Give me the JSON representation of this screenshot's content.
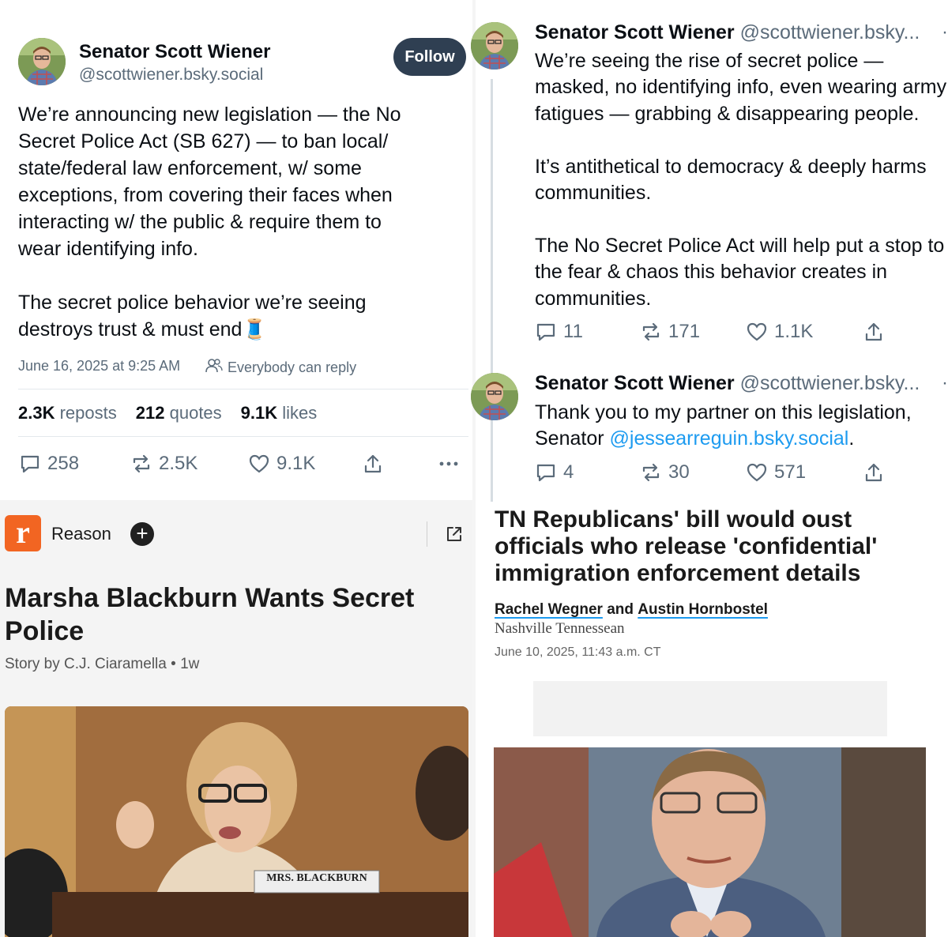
{
  "left_post": {
    "display_name": "Senator Scott Wiener",
    "handle": "@scottwiener.bsky.social",
    "follow_label": "Follow",
    "body": "We’re announcing new legislation — the No\nSecret Police Act (SB 627) — to ban local/\nstate/federal law enforcement, w/ some\nexceptions, from covering their faces when\ninteracting w/ the public & require them to\nwear identifying info.\n\nThe secret police behavior we’re seeing\ndestroys trust & must end🧵",
    "timestamp": "June 16, 2025 at 9:25 AM",
    "reply_setting": "Everybody can reply",
    "stats": {
      "reposts_count": "2.3K",
      "reposts_label": "reposts",
      "quotes_count": "212",
      "quotes_label": "quotes",
      "likes_count": "9.1K",
      "likes_label": "likes"
    },
    "actions": {
      "replies": "258",
      "reposts": "2.5K",
      "likes": "9.1K"
    }
  },
  "thread_post_1": {
    "display_name": "Senator Scott Wiener",
    "handle": "@scottwiener.bsky...",
    "body": "We’re seeing the rise of secret police —\nmasked, no identifying info, even wearing army\nfatigues — grabbing & disappearing people.\n\nIt’s antithetical to democracy & deeply harms\ncommunities.\n\nThe No Secret Police Act will help put a stop to\nthe fear & chaos this behavior creates in\ncommunities.",
    "actions": {
      "replies": "11",
      "reposts": "171",
      "likes": "1.1K"
    }
  },
  "thread_post_2": {
    "display_name": "Senator Scott Wiener",
    "handle": "@scottwiener.bsky...",
    "body_prefix": "Thank you to my partner on this legislation,\nSenator ",
    "mention": "@jessearreguin.bsky.social",
    "body_suffix": ".",
    "actions": {
      "replies": "4",
      "reposts": "30",
      "likes": "571"
    }
  },
  "reason_article": {
    "source": "Reason",
    "logo_letter": "r",
    "headline": "Marsha Blackburn Wants Secret Police",
    "byline": "Story by C.J. Ciaramella",
    "age": "1w",
    "nameplate": "MRS. BLACKBURN"
  },
  "tennessean_article": {
    "headline": "TN Republicans' bill would oust officials who release 'confidential' immigration enforcement details",
    "author_1": "Rachel Wegner",
    "author_join": "and",
    "author_2": "Austin Hornbostel",
    "publication": "Nashville Tennessean",
    "dateline": "June 10, 2025, 11:43 a.m. CT"
  },
  "colors": {
    "follow_button": "#2f3f52",
    "link": "#1d9bf0",
    "muted": "#5b6b7a",
    "reason_brand": "#f26522"
  }
}
